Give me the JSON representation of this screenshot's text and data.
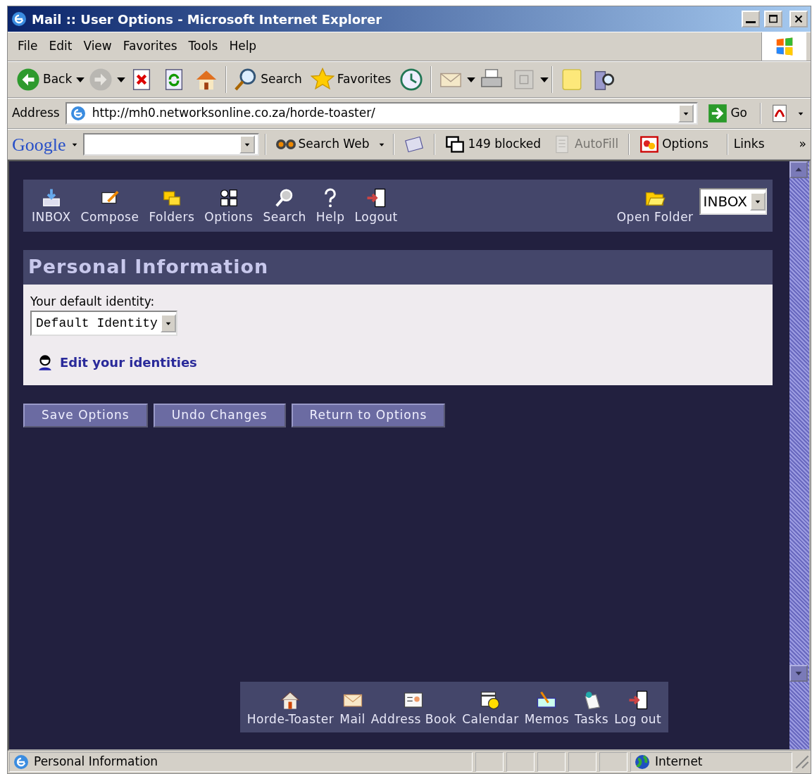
{
  "window": {
    "title": "Mail :: User Options - Microsoft Internet Explorer"
  },
  "menu": [
    "File",
    "Edit",
    "View",
    "Favorites",
    "Tools",
    "Help"
  ],
  "toolbar": [
    {
      "kind": "back",
      "label": "Back",
      "dropdown": true,
      "disabled": false
    },
    {
      "kind": "forward",
      "dropdown": true,
      "disabled": true
    },
    {
      "kind": "stop",
      "disabled": false
    },
    {
      "kind": "refresh",
      "disabled": false
    },
    {
      "kind": "home",
      "disabled": false
    },
    {
      "kind": "search",
      "label": "Search",
      "disabled": false
    },
    {
      "kind": "favorites",
      "label": "Favorites",
      "disabled": false
    },
    {
      "kind": "history",
      "disabled": false
    },
    {
      "kind": "mail",
      "dropdown": true,
      "disabled": false
    },
    {
      "kind": "print",
      "disabled": false
    },
    {
      "kind": "edit",
      "dropdown": true,
      "disabled": true
    },
    {
      "kind": "note",
      "disabled": false
    },
    {
      "kind": "research",
      "disabled": false
    }
  ],
  "address": {
    "label": "Address",
    "url": "http://mh0.networksonline.co.za/horde-toaster/",
    "go": "Go"
  },
  "google_bar": {
    "logo": "Google",
    "search_button": "Search Web",
    "blocked": "149 blocked",
    "autofill": {
      "label": "AutoFill",
      "disabled": true
    },
    "options": "Options",
    "links": "Links",
    "more": "»"
  },
  "mail_nav": [
    {
      "kind": "inbox",
      "label": "INBOX"
    },
    {
      "kind": "compose",
      "label": "Compose"
    },
    {
      "kind": "folders",
      "label": "Folders"
    },
    {
      "kind": "options",
      "label": "Options"
    },
    {
      "kind": "search",
      "label": "Search"
    },
    {
      "kind": "help",
      "label": "Help"
    },
    {
      "kind": "logout",
      "label": "Logout"
    }
  ],
  "open_folder": {
    "label": "Open Folder",
    "folder": "INBOX"
  },
  "section": {
    "title": "Personal Information",
    "identity_label": "Your default identity:",
    "identity": "Default Identity",
    "edit_link": "Edit your identities"
  },
  "buttons": [
    "Save Options",
    "Undo Changes",
    "Return to Options"
  ],
  "app_nav": [
    {
      "kind": "home",
      "label": "Horde-Toaster"
    },
    {
      "kind": "mail",
      "label": "Mail"
    },
    {
      "kind": "addressbook",
      "label": "Address Book"
    },
    {
      "kind": "calendar",
      "label": "Calendar"
    },
    {
      "kind": "memos",
      "label": "Memos"
    },
    {
      "kind": "tasks",
      "label": "Tasks"
    },
    {
      "kind": "logout",
      "label": "Log out"
    }
  ],
  "status_bar": {
    "text": "Personal Information",
    "zone": "Internet"
  }
}
